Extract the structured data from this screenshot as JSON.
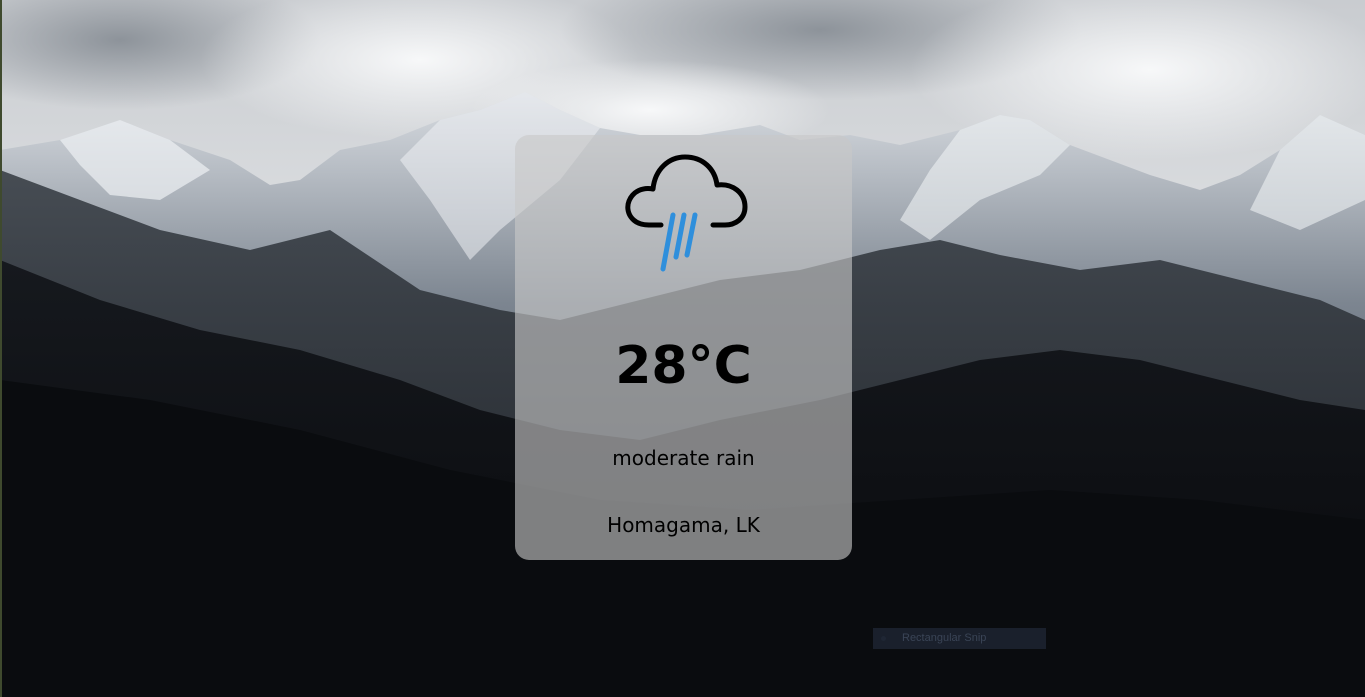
{
  "weather": {
    "icon": "rain-cloud-icon",
    "temperature": "28°C",
    "description": "moderate rain",
    "location": "Homagama, LK"
  },
  "overlay": {
    "snip_label": "Rectangular Snip"
  },
  "colors": {
    "card_background": "#c8c8c8",
    "rain_accent": "#2f8fdc",
    "text": "#000000"
  }
}
